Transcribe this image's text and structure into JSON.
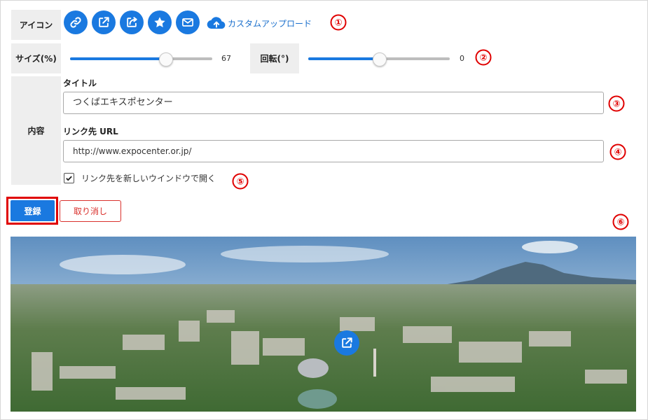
{
  "labels": {
    "icon": "アイコン",
    "size": "サイズ(%)",
    "rotation": "回転(°)",
    "content": "内容"
  },
  "icons": [
    {
      "name": "link-icon",
      "selected": false
    },
    {
      "name": "external-link-icon",
      "selected": true
    },
    {
      "name": "share-icon",
      "selected": false
    },
    {
      "name": "star-icon",
      "selected": false
    },
    {
      "name": "mail-icon",
      "selected": false
    }
  ],
  "custom_upload": {
    "label": "カスタムアップロード",
    "icon": "cloud-upload-icon"
  },
  "size_slider": {
    "value": 67,
    "max": 100,
    "display": "67"
  },
  "rotation_slider": {
    "value": 0,
    "display": "0"
  },
  "title_field": {
    "label": "タイトル",
    "value": "つくばエキスポセンター"
  },
  "url_field": {
    "label": "リンク先 URL",
    "value": "http://www.expocenter.or.jp/"
  },
  "new_window": {
    "label": "リンク先を新しいウインドウで開く",
    "checked": true
  },
  "buttons": {
    "register": "登録",
    "cancel": "取り消し"
  },
  "callouts": [
    "①",
    "②",
    "③",
    "④",
    "⑤",
    "⑥"
  ],
  "preview": {
    "description_icon": "external-link-icon"
  },
  "colors": {
    "accent": "#1a79e0",
    "callout": "#e00000",
    "highlight_border": "#e00000",
    "cancel_text": "#d9302c"
  }
}
